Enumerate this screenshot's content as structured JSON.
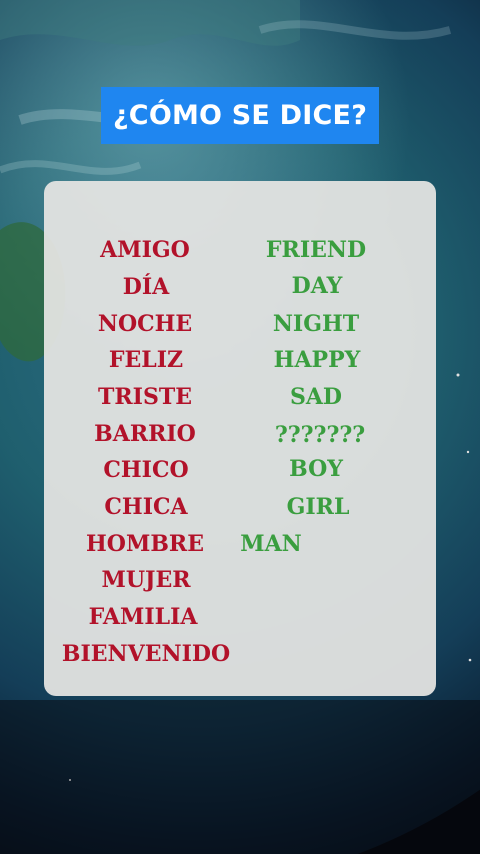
{
  "title": "¿CÓMO SE DICE?",
  "colors": {
    "spanish": "#b2122a",
    "english": "#3a9e3f",
    "banner": "#1f86f0"
  },
  "spanish_words": [
    "AMIGO",
    "DÍA",
    "NOCHE",
    "FELIZ",
    "TRISTE",
    "BARRIO",
    "CHICO",
    "CHICA",
    "HOMBRE",
    "MUJER",
    "FAMILIA",
    "BIENVENIDO"
  ],
  "english_words": [
    "FRIEND",
    "DAY",
    "NIGHT",
    "HAPPY",
    "SAD",
    "???????",
    "BOY",
    "GIRL",
    "MAN"
  ]
}
